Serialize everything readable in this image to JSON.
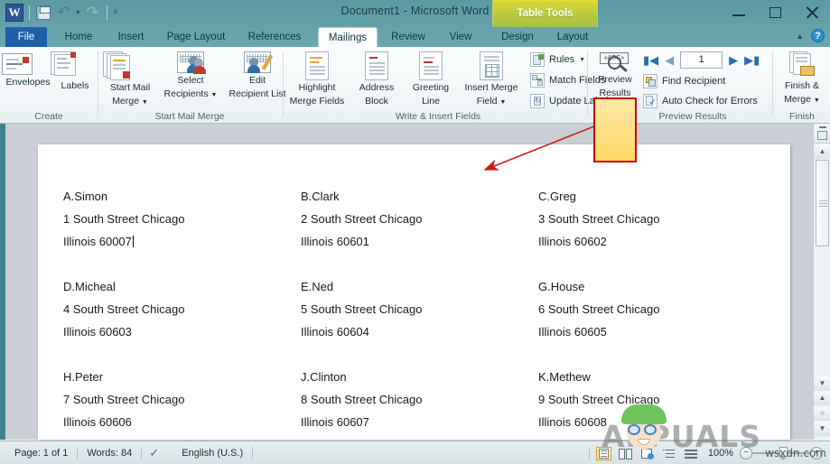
{
  "window": {
    "title": "Document1  -  Microsoft Word",
    "quick_access": [
      {
        "name": "word-logo",
        "label": "W"
      },
      {
        "name": "save-icon",
        "label": "Save"
      },
      {
        "name": "undo-icon",
        "label": "Undo"
      },
      {
        "name": "redo-icon",
        "label": "Redo"
      },
      {
        "name": "customize-qat-icon",
        "label": "Customize Quick Access Toolbar"
      }
    ],
    "contextual_banner": "Table Tools",
    "controls": {
      "minimize": "Minimize",
      "maximize": "Maximize",
      "close": "Close"
    },
    "help": "?",
    "collapse_ribbon": "Minimize the Ribbon"
  },
  "tabs": [
    {
      "label": "File",
      "active": false,
      "file": true
    },
    {
      "label": "Home",
      "active": false
    },
    {
      "label": "Insert",
      "active": false
    },
    {
      "label": "Page Layout",
      "active": false
    },
    {
      "label": "References",
      "active": false
    },
    {
      "label": "Mailings",
      "active": true
    },
    {
      "label": "Review",
      "active": false
    },
    {
      "label": "View",
      "active": false
    },
    {
      "label": "Design",
      "active": false
    },
    {
      "label": "Layout",
      "active": false
    }
  ],
  "ribbon": {
    "groups": [
      {
        "name": "create",
        "label": "Create"
      },
      {
        "name": "start-mail-merge",
        "label": "Start Mail Merge"
      },
      {
        "name": "write-insert",
        "label": "Write & Insert Fields"
      },
      {
        "name": "preview-results",
        "label": "Preview Results"
      },
      {
        "name": "finish",
        "label": "Finish"
      }
    ],
    "create": {
      "envelopes": "Envelopes",
      "labels": "Labels"
    },
    "start_mail_merge": {
      "start_mail_merge_l1": "Start Mail",
      "start_mail_merge_l2": "Merge",
      "select_recipients_l1": "Select",
      "select_recipients_l2": "Recipients",
      "edit_recipient_list_l1": "Edit",
      "edit_recipient_list_l2": "Recipient List"
    },
    "write_insert": {
      "highlight_l1": "Highlight",
      "highlight_l2": "Merge Fields",
      "address_block_l1": "Address",
      "address_block_l2": "Block",
      "greeting_line_l1": "Greeting",
      "greeting_line_l2": "Line",
      "insert_merge_field_l1": "Insert Merge",
      "insert_merge_field_l2": "Field",
      "rules": "Rules",
      "match_fields": "Match Fields",
      "update_labels": "Update Labels"
    },
    "preview": {
      "preview_results_l1": "Preview",
      "preview_results_l2": "Results",
      "record_number": "1",
      "first_record": "First Record",
      "previous_record": "Previous Record",
      "next_record": "Next Record",
      "last_record": "Last Record",
      "find_recipient": "Find Recipient",
      "auto_check": "Auto Check for Errors",
      "highlight_color": "#cc0000"
    },
    "finish": {
      "finish_merge_l1": "Finish &",
      "finish_merge_l2": "Merge"
    }
  },
  "document": {
    "rows": [
      [
        {
          "name": "A.Simon",
          "address": "1 South Street Chicago",
          "city": "Illinois 60007",
          "caret": true
        },
        {
          "name": "B.Clark",
          "address": "2 South Street Chicago",
          "city": "Illinois 60601",
          "caret": false
        },
        {
          "name": "C.Greg",
          "address": "3 South Street Chicago",
          "city": "Illinois 60602",
          "caret": false
        }
      ],
      [
        {
          "name": "D.Micheal",
          "address": "4 South Street Chicago",
          "city": "Illinois 60603",
          "caret": false
        },
        {
          "name": "E.Ned",
          "address": "5 South Street Chicago",
          "city": "Illinois 60604",
          "caret": false
        },
        {
          "name": "G.House",
          "address": "6 South Street Chicago",
          "city": "Illinois 60605",
          "caret": false
        }
      ],
      [
        {
          "name": "H.Peter",
          "address": "7 South Street Chicago",
          "city": "Illinois 60606",
          "caret": false
        },
        {
          "name": "J.Clinton",
          "address": "8 South Street Chicago",
          "city": "Illinois 60607",
          "caret": false
        },
        {
          "name": "K.Methew",
          "address": "9 South Street Chicago",
          "city": "Illinois 60608",
          "caret": false
        }
      ]
    ]
  },
  "status_bar": {
    "page": "Page: 1 of 1",
    "words": "Words: 84",
    "proofing": "Proofing errors",
    "language": "English (U.S.)",
    "views": [
      {
        "name": "print-layout-view",
        "selected": true
      },
      {
        "name": "full-screen-reading-view",
        "selected": false
      },
      {
        "name": "web-layout-view",
        "selected": false
      },
      {
        "name": "outline-view",
        "selected": false
      },
      {
        "name": "draft-view",
        "selected": false
      }
    ],
    "zoom": "100%",
    "zoom_out": "−",
    "zoom_in": "+"
  },
  "watermark": {
    "brand": "APPUALS",
    "site": "wsxdn.com"
  }
}
